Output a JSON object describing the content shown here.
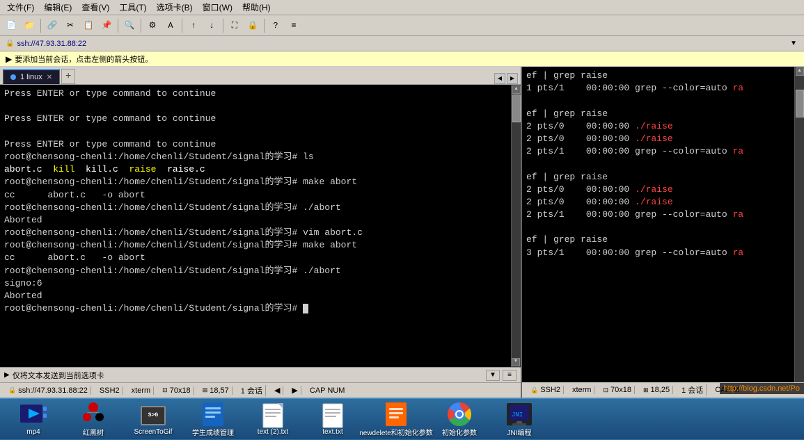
{
  "menu": {
    "items": [
      "文件(F)",
      "编辑(E)",
      "查看(V)",
      "工具(T)",
      "选项卡(B)",
      "窗口(W)",
      "帮助(H)"
    ]
  },
  "session": {
    "url": "ssh://47.93.31.88:22",
    "notice": "要添加当前会话，点击左侧的箭头按钮。"
  },
  "tabs": {
    "active": "1 linux",
    "add_label": "+"
  },
  "terminal_left": {
    "lines": [
      {
        "text": "Press ENTER or type command to continue",
        "color": "normal"
      },
      {
        "text": "",
        "color": "normal"
      },
      {
        "text": "Press ENTER or type command to continue",
        "color": "normal"
      },
      {
        "text": "",
        "color": "normal"
      },
      {
        "text": "Press ENTER or type command to continue",
        "color": "normal"
      },
      {
        "text": "root@chensong-chenli:/home/chenli/Student/signal的学习# ls",
        "color": "normal"
      },
      {
        "text": "abort.c  kill  kill.c  raise  raise.c",
        "has_colors": true
      },
      {
        "text": "root@chensong-chenli:/home/chenli/Student/signal的学习# make abort",
        "color": "normal"
      },
      {
        "text": "cc      abort.c   -o abort",
        "color": "normal"
      },
      {
        "text": "root@chensong-chenli:/home/chenli/Student/signal的学习# ./abort",
        "color": "normal"
      },
      {
        "text": "Aborted",
        "color": "normal"
      },
      {
        "text": "root@chensong-chenli:/home/chenli/Student/signal的学习# vim abort.c",
        "color": "normal"
      },
      {
        "text": "root@chensong-chenli:/home/chenli/Student/signal的学习# make abort",
        "color": "normal"
      },
      {
        "text": "cc      abort.c   -o abort",
        "color": "normal"
      },
      {
        "text": "root@chensong-chenli:/home/chenli/Student/signal的学习# ./abort",
        "color": "normal"
      },
      {
        "text": "signo:6",
        "color": "normal"
      },
      {
        "text": "Aborted",
        "color": "normal"
      },
      {
        "text": "root@chensong-chenli:/home/chenli/Student/signal的学习# ",
        "color": "normal",
        "has_cursor": true
      }
    ]
  },
  "terminal_right": {
    "lines": [
      {
        "text": "ef | grep raise"
      },
      {
        "text": "1 pts/1    00:00:00 grep --color=auto ra",
        "truncated": true
      },
      {
        "text": ""
      },
      {
        "text": "ef | grep raise"
      },
      {
        "text": "2 pts/0    00:00:00 ./raise",
        "color": "red"
      },
      {
        "text": "2 pts/0    00:00:00 ./raise",
        "color": "red"
      },
      {
        "text": "2 pts/1    00:00:00 grep --color=auto ra",
        "truncated": true
      },
      {
        "text": ""
      },
      {
        "text": "ef | grep raise"
      },
      {
        "text": "2 pts/0    00:00:00 ./raise",
        "color": "red"
      },
      {
        "text": "2 pts/0    00:00:00 ./raise",
        "color": "red"
      },
      {
        "text": "2 pts/1    00:00:00 grep --color=auto ra",
        "truncated": true
      },
      {
        "text": ""
      },
      {
        "text": "ef | grep raise"
      },
      {
        "text": "3 pts/1    00:00:00 grep --color=auto ra",
        "truncated": true
      }
    ]
  },
  "status_left": {
    "ssh": "ssh://47.93.31.88:22",
    "protocol": "SSH2",
    "term": "xterm",
    "size": "70x18",
    "position": "18,57",
    "sessions": "1 会话",
    "encoding": "CAP NUM"
  },
  "status_right": {
    "protocol": "SSH2",
    "term": "xterm",
    "size": "70x18",
    "position": "18,25",
    "sessions": "1 会话",
    "encoding": "CAP M"
  },
  "send_bar": {
    "label": "仅将文本发送到当前选项卡"
  },
  "taskbar": {
    "items": [
      {
        "label": "mp4",
        "icon": "video-icon"
      },
      {
        "label": "红黑树",
        "icon": "red-tree-icon"
      },
      {
        "label": "ScreenToGif",
        "icon": "screen-gif-icon"
      },
      {
        "label": "学生成绩管理",
        "icon": "book-icon"
      },
      {
        "label": "text (2).txt",
        "icon": "text-icon"
      },
      {
        "label": "text.txt",
        "icon": "text-icon-2"
      },
      {
        "label": "newdelete和初始化参数",
        "icon": "doc-icon"
      },
      {
        "label": "初始化参数",
        "icon": "chrome-icon"
      },
      {
        "label": "JNI编程",
        "icon": "jni-icon"
      }
    ]
  },
  "blog_url": "http://blog.csdn.net/Po"
}
